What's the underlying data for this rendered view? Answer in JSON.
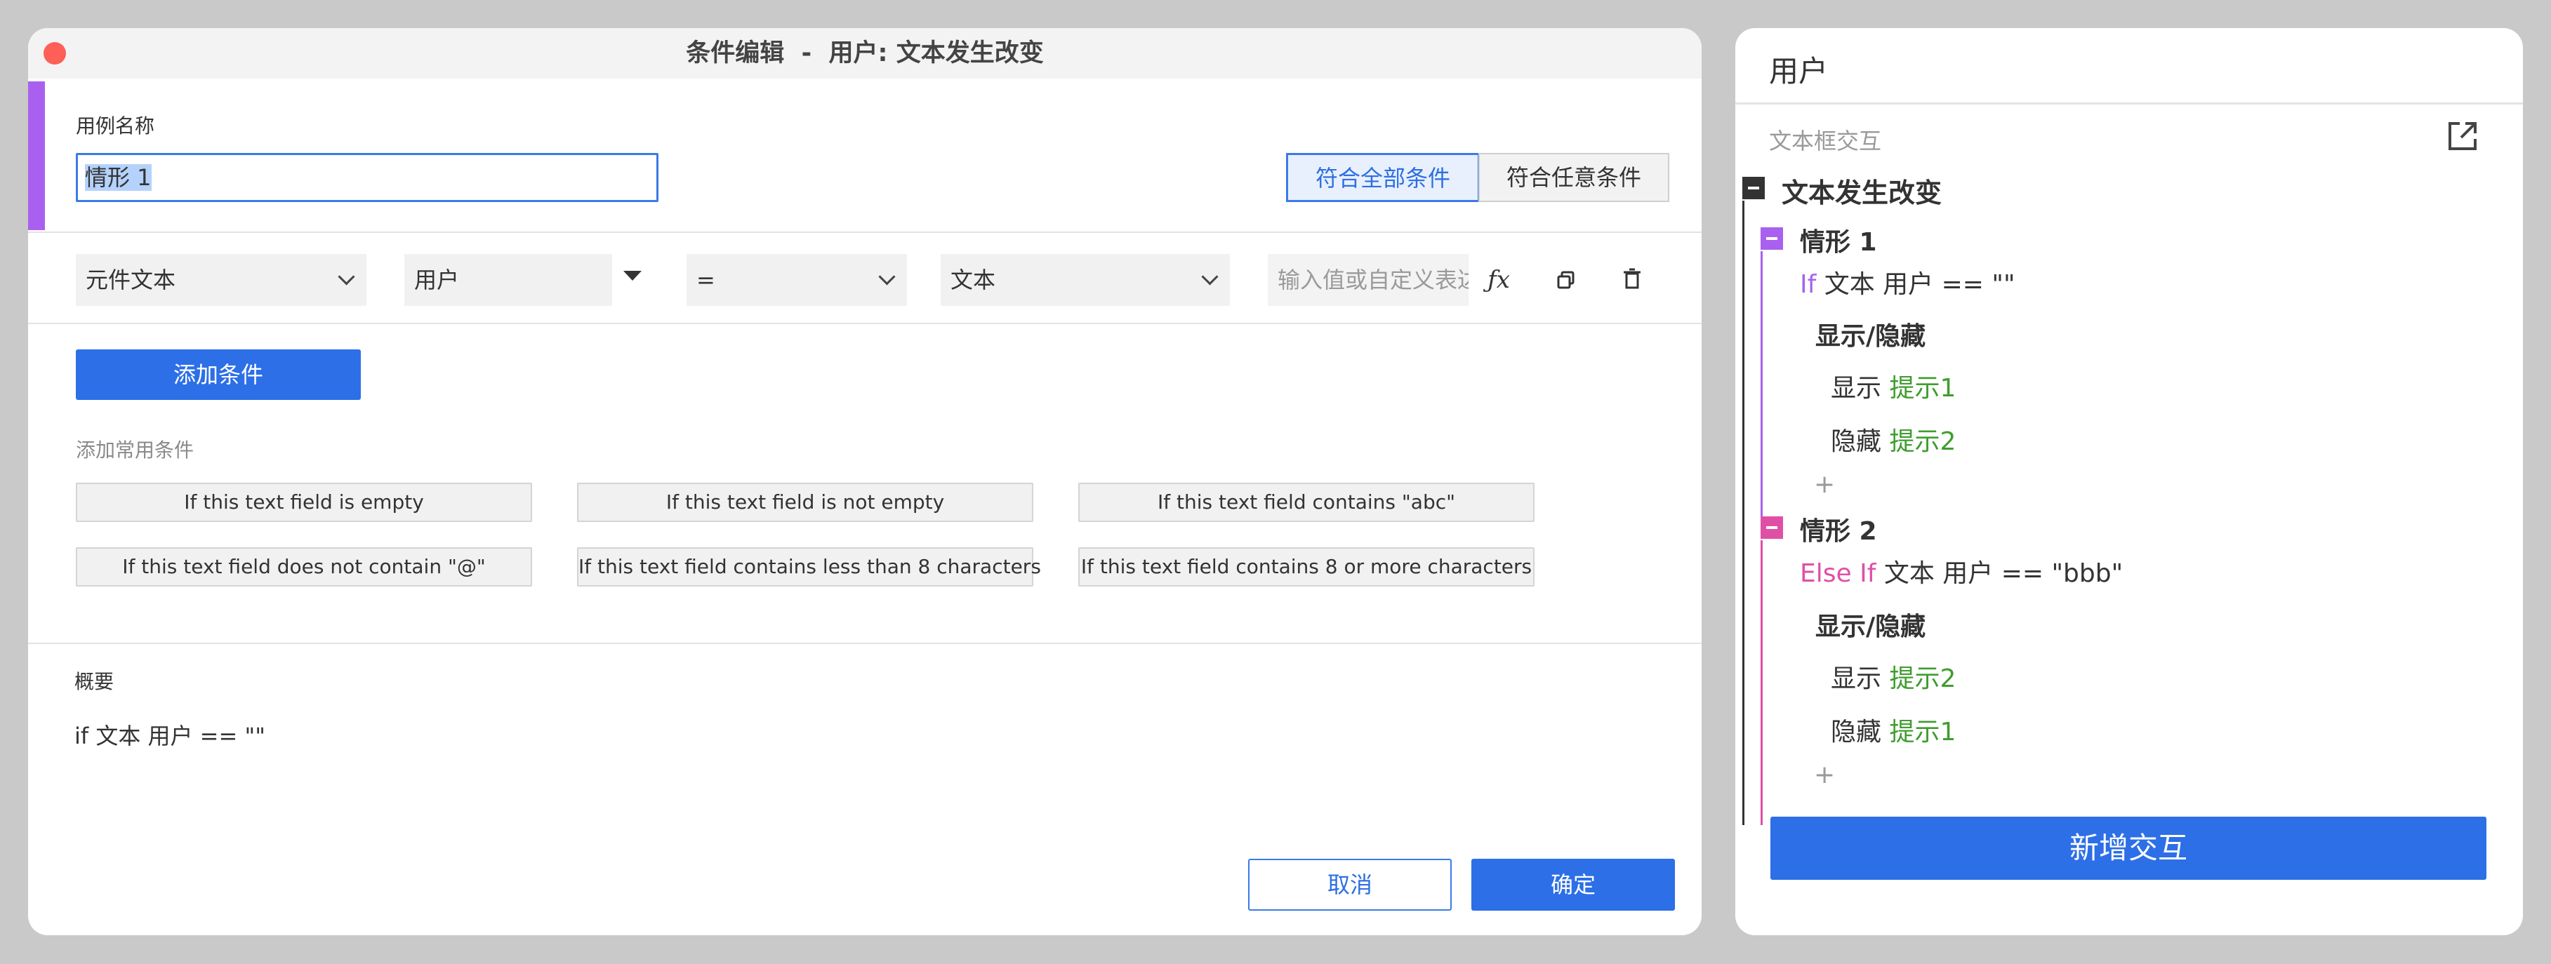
{
  "dialog": {
    "title": "条件编辑  -  用户: 文本发生改变",
    "case_name_label": "用例名称",
    "case_name_value": "情形 1",
    "match_all_label": "符合全部条件",
    "match_any_label": "符合任意条件",
    "condition_row": {
      "source": "元件文本",
      "target": "用户",
      "operator": "=",
      "value_type": "文本",
      "value_placeholder": "输入值或自定义表达式"
    },
    "add_condition_label": "添加条件",
    "common_conditions_label": "添加常用条件",
    "common_conditions": [
      "If this text field is empty",
      "If this text field is not empty",
      "If this text field contains \"abc\"",
      "If this text field does not contain \"@\"",
      "If this text field contains less than 8 characters",
      "If this text field contains 8 or more characters"
    ],
    "summary_label": "概要",
    "summary_text": "if 文本 用户 == \"\"",
    "cancel_label": "取消",
    "ok_label": "确定"
  },
  "side": {
    "title": "用户",
    "section_label": "文本框交互",
    "event_label": "文本发生改变",
    "cases": [
      {
        "name": "情形 1",
        "keyword": "If",
        "condition": " 文本 用户 == \"\"",
        "action_group": "显示/隐藏",
        "actions": [
          {
            "verb": "显示",
            "target": "提示1"
          },
          {
            "verb": "隐藏",
            "target": "提示2"
          }
        ],
        "add_label": "+"
      },
      {
        "name": "情形 2",
        "keyword": "Else If",
        "condition": " 文本 用户 == \"bbb\"",
        "action_group": "显示/隐藏",
        "actions": [
          {
            "verb": "显示",
            "target": "提示2"
          },
          {
            "verb": "隐藏",
            "target": "提示1"
          }
        ],
        "add_label": "+"
      }
    ],
    "new_interaction_label": "新增交互"
  },
  "colors": {
    "accent_blue": "#2c6fe7",
    "case1_purple": "#a960ef",
    "case2_pink": "#e04fa6",
    "target_green": "#3f9d2e",
    "close_red": "#fe5f57"
  },
  "icons": [
    "close-dot-icon",
    "dropdown-chevron-icon",
    "function-icon",
    "duplicate-icon",
    "trash-icon",
    "external-link-icon",
    "collapse-icon"
  ]
}
